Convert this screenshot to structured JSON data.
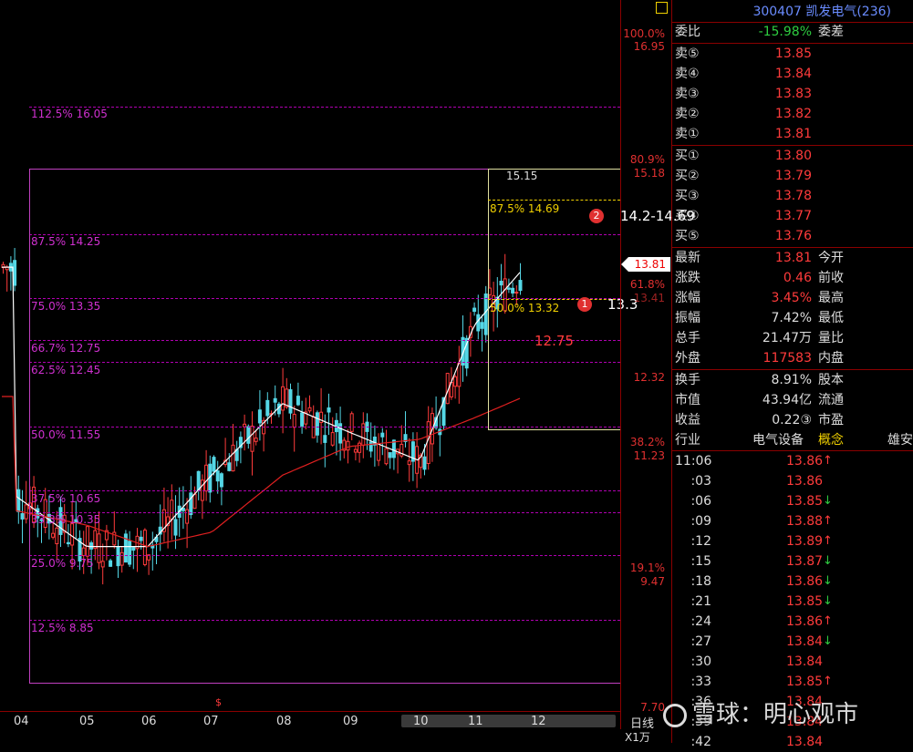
{
  "header": {
    "code": "300407",
    "name": "凯发电气",
    "count": "(236)"
  },
  "weibi": {
    "label": "委比",
    "value": "-15.98%",
    "label2": "委差"
  },
  "sell": [
    {
      "label": "卖⑤",
      "price": "13.85"
    },
    {
      "label": "卖④",
      "price": "13.84"
    },
    {
      "label": "卖③",
      "price": "13.83"
    },
    {
      "label": "卖②",
      "price": "13.82"
    },
    {
      "label": "卖①",
      "price": "13.81"
    }
  ],
  "buy": [
    {
      "label": "买①",
      "price": "13.80"
    },
    {
      "label": "买②",
      "price": "13.79"
    },
    {
      "label": "买③",
      "price": "13.78"
    },
    {
      "label": "买④",
      "price": "13.77"
    },
    {
      "label": "买⑤",
      "price": "13.76"
    }
  ],
  "stats": [
    {
      "k": "最新",
      "v": "13.81",
      "k2": "今开",
      "c": "red"
    },
    {
      "k": "涨跌",
      "v": "0.46",
      "k2": "前收",
      "c": "red"
    },
    {
      "k": "涨幅",
      "v": "3.45%",
      "k2": "最高",
      "c": "red"
    },
    {
      "k": "振幅",
      "v": "7.42%",
      "k2": "最低",
      "c": "white"
    },
    {
      "k": "总手",
      "v": "21.47万",
      "k2": "量比",
      "c": "white"
    },
    {
      "k": "外盘",
      "v": "117583",
      "k2": "内盘",
      "c": "red"
    }
  ],
  "stats2": [
    {
      "k": "换手",
      "v": "8.91%",
      "k2": "股本"
    },
    {
      "k": "市值",
      "v": "43.94亿",
      "k2": "流通"
    },
    {
      "k": "收益",
      "v": "0.22③",
      "k2": "市盈"
    }
  ],
  "industry": {
    "label": "行业",
    "value": "电气设备",
    "concept": "概念",
    "extra": "雄安"
  },
  "ticks": [
    {
      "t": "11:06",
      "p": "13.86",
      "a": "↑",
      "c": "red"
    },
    {
      "t": ":03",
      "p": "13.86",
      "a": "",
      "c": "red"
    },
    {
      "t": ":06",
      "p": "13.85",
      "a": "↓",
      "c": "green"
    },
    {
      "t": ":09",
      "p": "13.88",
      "a": "↑",
      "c": "red"
    },
    {
      "t": ":12",
      "p": "13.89",
      "a": "↑",
      "c": "red"
    },
    {
      "t": ":15",
      "p": "13.87",
      "a": "↓",
      "c": "green"
    },
    {
      "t": ":18",
      "p": "13.86",
      "a": "↓",
      "c": "green"
    },
    {
      "t": ":21",
      "p": "13.85",
      "a": "↓",
      "c": "green"
    },
    {
      "t": ":24",
      "p": "13.86",
      "a": "↑",
      "c": "red"
    },
    {
      "t": ":27",
      "p": "13.84",
      "a": "↓",
      "c": "green"
    },
    {
      "t": ":30",
      "p": "13.84",
      "a": "",
      "c": "red"
    },
    {
      "t": ":33",
      "p": "13.85",
      "a": "↑",
      "c": "red"
    },
    {
      "t": ":36",
      "p": "13.84",
      "a": "",
      "c": "red"
    },
    {
      "t": ":39",
      "p": "13.84",
      "a": "",
      "c": "red"
    },
    {
      "t": ":42",
      "p": "13.84",
      "a": "",
      "c": "red"
    }
  ],
  "axis": [
    {
      "text": "100.0%",
      "c": "red"
    },
    {
      "text": "16.95",
      "c": "red"
    },
    {
      "text": "80.9%",
      "c": "red"
    },
    {
      "text": "15.18",
      "c": "red"
    },
    {
      "text": "61.8%",
      "c": "red"
    },
    {
      "text": "13.41",
      "c": "red"
    },
    {
      "text": "12.32",
      "c": "red"
    },
    {
      "text": "38.2%",
      "c": "red"
    },
    {
      "text": "11.23",
      "c": "red"
    },
    {
      "text": "19.1%",
      "c": "red"
    },
    {
      "text": "9.47",
      "c": "red"
    },
    {
      "text": "7.70",
      "c": "red"
    }
  ],
  "current_price_tag": "13.81",
  "fib": [
    {
      "label": "112.5% 16.05"
    },
    {
      "label": "87.5% 14.25"
    },
    {
      "label": "75.0% 13.35"
    },
    {
      "label": "66.7% 12.75"
    },
    {
      "label": "62.5% 12.45"
    },
    {
      "label": "50.0% 11.55"
    },
    {
      "label": "37.5% 10.65"
    },
    {
      "label": "33.3% 10.35"
    },
    {
      "label": "25.0% 9.75"
    },
    {
      "label": "12.5% 8.85"
    }
  ],
  "inner_fib": {
    "top": "15.15",
    "l875": "87.5% 14.69",
    "l50": "50.0% 13.32"
  },
  "annotations": [
    {
      "num": "2",
      "text": "14.2-14.69"
    },
    {
      "num": "1",
      "text": "13.3"
    },
    {
      "num": "",
      "text": "12.75"
    }
  ],
  "months": [
    "04",
    "05",
    "06",
    "07",
    "08",
    "09",
    "10",
    "11",
    "12"
  ],
  "period": "日线",
  "scale": "X1万",
  "watermark": "雪球：明心观市",
  "chart_data": {
    "type": "line",
    "title": "",
    "x": [
      "04",
      "05",
      "06",
      "07",
      "08",
      "09",
      "10",
      "11",
      "12"
    ],
    "series": [
      {
        "values": [
          10.6,
          9.9,
          9.9,
          10.9,
          11.9,
          11.5,
          11.1,
          13.0,
          13.81
        ]
      },
      {
        "values": [
          10.4,
          10.2,
          9.9,
          10.1,
          10.9,
          11.3,
          11.4,
          11.7,
          12.0
        ]
      }
    ],
    "ylim": [
      7.7,
      16.95
    ]
  }
}
